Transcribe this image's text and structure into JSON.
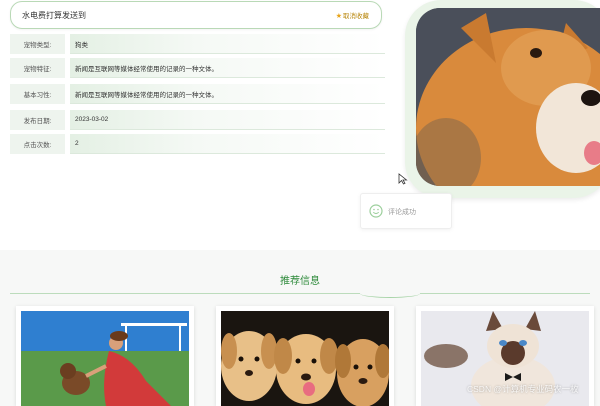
{
  "header": {
    "title": "水电费打算发送到",
    "favorite_label": "取消收藏"
  },
  "details": [
    {
      "label": "宠物类型:",
      "value": "狗类"
    },
    {
      "label": "宠物特征:",
      "value": "新闻是互联网等媒体经常使用的记录的一种文体。"
    },
    {
      "label": "基本习性:",
      "value": "新闻是互联网等媒体经常使用的记录的一种文体。"
    },
    {
      "label": "发布日期:",
      "value": "2023-03-02"
    },
    {
      "label": "点击次数:",
      "value": "2"
    }
  ],
  "toast": {
    "message": "评论成功"
  },
  "recommend": {
    "title": "推荐信息"
  },
  "watermark": "CSDN @计算机专业码农一枚",
  "colors": {
    "accent_green": "#2d8a3a",
    "border_green": "#b9d9b6",
    "star": "#e8a317"
  }
}
